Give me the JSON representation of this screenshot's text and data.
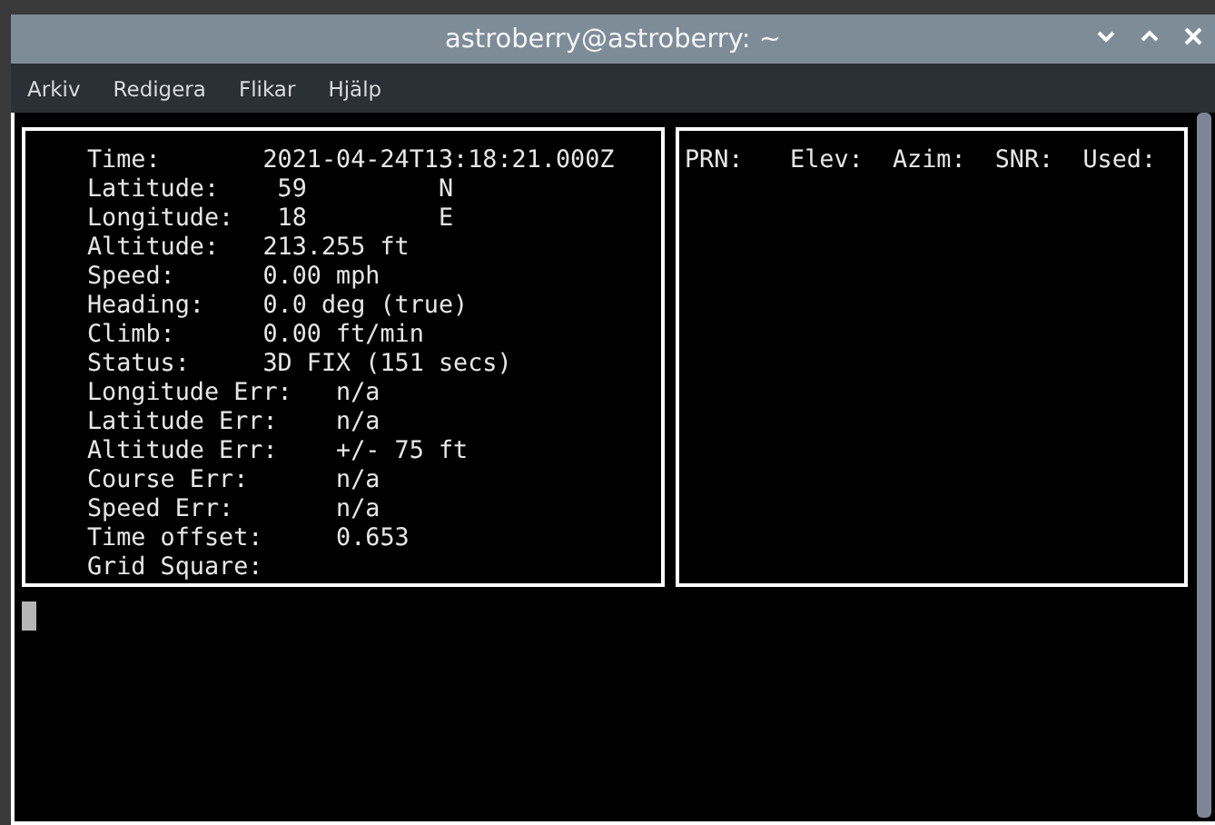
{
  "window": {
    "title": "astroberry@astroberry: ~"
  },
  "menu": [
    "Arkiv",
    "Redigera",
    "Flikar",
    "Hjälp"
  ],
  "fix_panel": {
    "rows": [
      {
        "kind": "fix",
        "label": "Time:",
        "value": "2021-04-24T13:18:21.000Z"
      },
      {
        "kind": "coordinate",
        "label": "Latitude:",
        "value": "59",
        "hemisphere": "N"
      },
      {
        "kind": "coordinate",
        "label": "Longitude:",
        "value": "18",
        "hemisphere": "E"
      },
      {
        "kind": "fix",
        "label": "Altitude:",
        "value": "213.255 ft"
      },
      {
        "kind": "fix",
        "label": "Speed:",
        "value": "0.00 mph"
      },
      {
        "kind": "fix",
        "label": "Heading:",
        "value": "0.0 deg (true)"
      },
      {
        "kind": "fix",
        "label": "Climb:",
        "value": "0.00 ft/min"
      },
      {
        "kind": "fix",
        "label": "Status:",
        "value": "3D FIX (151 secs)"
      },
      {
        "kind": "error",
        "label": "Longitude Err:",
        "value": "n/a"
      },
      {
        "kind": "error",
        "label": "Latitude Err:",
        "value": "n/a"
      },
      {
        "kind": "error",
        "label": "Altitude Err:",
        "value": "+/- 75 ft"
      },
      {
        "kind": "error",
        "label": "Course Err:",
        "value": "n/a"
      },
      {
        "kind": "error",
        "label": "Speed Err:",
        "value": "n/a"
      },
      {
        "kind": "error",
        "label": "Time offset:",
        "value": "0.653"
      },
      {
        "kind": "error",
        "label": "Grid Square:"
      }
    ]
  },
  "satellite_panel": {
    "columns": [
      "PRN:",
      "Elev:",
      "Azim:",
      "SNR:",
      "Used:"
    ]
  }
}
